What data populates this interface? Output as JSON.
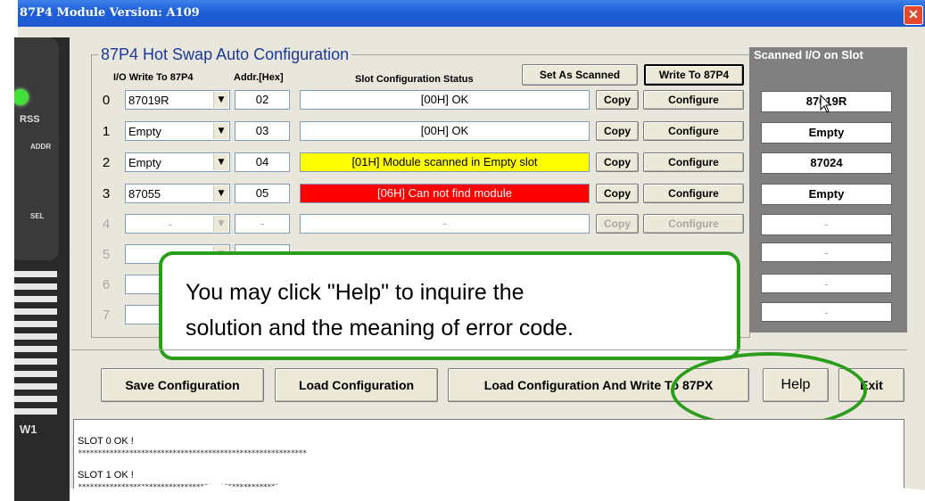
{
  "window": {
    "title": "87P4 Module Version: A109",
    "close_glyph": "✕"
  },
  "device": {
    "label_top": "RSS",
    "label_side1": "ADDR",
    "label_side2": "SEL",
    "label_bottom": "W1"
  },
  "config": {
    "group_title": "87P4 Hot Swap Auto Configuration",
    "col_io": "I/O Write To 87P4",
    "col_addr": "Addr.[Hex]",
    "col_status": "Slot Configuration Status",
    "set_as_scanned": "Set As Scanned",
    "write_to": "Write To 87P4",
    "copy_label": "Copy",
    "configure_label": "Configure",
    "rows": [
      {
        "num": "0",
        "module": "87019R",
        "addr": "02",
        "status": "[00H] OK"
      },
      {
        "num": "1",
        "module": "Empty",
        "addr": "03",
        "status": "[00H] OK"
      },
      {
        "num": "2",
        "module": "Empty",
        "addr": "04",
        "status": "[01H] Module scanned in Empty slot"
      },
      {
        "num": "3",
        "module": "87055",
        "addr": "05",
        "status": "[06H] Can not find module"
      },
      {
        "num": "4",
        "module": "-",
        "addr": "-",
        "status": "-"
      },
      {
        "num": "5",
        "module": "-",
        "addr": "",
        "status": ""
      },
      {
        "num": "6",
        "module": "-",
        "addr": "",
        "status": ""
      },
      {
        "num": "7",
        "module": "-",
        "addr": "",
        "status": ""
      }
    ]
  },
  "scanned": {
    "title": "Scanned I/O on Slot",
    "items": [
      "87019R",
      "Empty",
      "87024",
      "Empty",
      "-",
      "-",
      "-",
      "-"
    ]
  },
  "callout": {
    "line1": "You may click \"Help\" to inquire the",
    "line2": "solution and the meaning of error code."
  },
  "buttons": {
    "save": "Save Configuration",
    "load": "Load Configuration",
    "load_write": "Load  Configuration And Write To 87PX",
    "help": "Help",
    "exit": "Exit"
  },
  "log": {
    "lines": [
      "SLOT 0 OK !",
      "SLOT 1 OK !"
    ],
    "separator": "**********************************************************"
  },
  "colors": {
    "accent_green": "#2a9d1a",
    "warn_yellow": "#ffff00",
    "error_red": "#ff0000",
    "title_blue": "#1c5fd7"
  }
}
